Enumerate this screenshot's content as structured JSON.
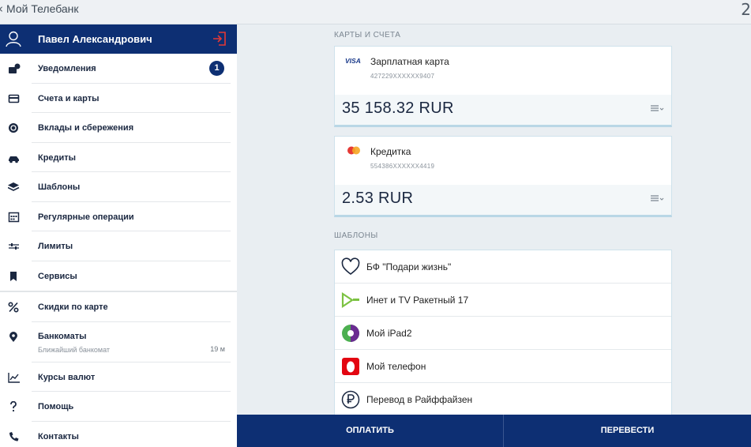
{
  "topbar": {
    "back_glyph": "‹",
    "title": "Мой Телебанк",
    "right_glyph": "2"
  },
  "profile": {
    "name": "Павел Александрович",
    "avatar_icon": "user-icon",
    "logout_icon": "logout-icon"
  },
  "menu": [
    {
      "label": "Уведомления",
      "icon": "notifications-icon",
      "badge": "1"
    },
    {
      "label": "Счета и карты",
      "icon": "card-icon"
    },
    {
      "label": "Вклады и сбережения",
      "icon": "savings-icon"
    },
    {
      "label": "Кредиты",
      "icon": "credit-icon"
    },
    {
      "label": "Шаблоны",
      "icon": "templates-icon"
    },
    {
      "label": "Регулярные операции",
      "icon": "calendar-icon"
    },
    {
      "label": "Лимиты",
      "icon": "limits-icon"
    },
    {
      "label": "Сервисы",
      "icon": "bookmark-icon"
    },
    {
      "label": "Скидки по карте",
      "icon": "percent-icon"
    },
    {
      "label": "Банкоматы",
      "icon": "location-icon",
      "sub": "Ближайший банкомат",
      "dist": "19 м"
    },
    {
      "label": "Курсы валют",
      "icon": "chart-icon"
    },
    {
      "label": "Помощь",
      "icon": "help-icon"
    },
    {
      "label": "Контакты",
      "icon": "phone-icon"
    }
  ],
  "accounts": {
    "title": "КАРТЫ И СЧЕТА",
    "cards": [
      {
        "name": "Зарплатная карта",
        "number": "427229XXXXXX9407",
        "amount": "35 158.32 RUR",
        "brand": "VISA"
      },
      {
        "name": "Кредитка",
        "number": "554386XXXXXX4419",
        "amount": "2.53 RUR",
        "brand": "MasterCard"
      }
    ]
  },
  "templates": {
    "title": "ШАБЛОНЫ",
    "items": [
      {
        "label": "БФ \"Подари жизнь\"",
        "icon": "heart-icon"
      },
      {
        "label": "Инет и  TV Ракетный 17",
        "icon": "provider-icon"
      },
      {
        "label": "Мой iPad2",
        "icon": "megafon-icon"
      },
      {
        "label": "Мой телефон",
        "icon": "mts-icon"
      },
      {
        "label": "Перевод в Райффайзен",
        "icon": "ruble-transfer-icon"
      }
    ]
  },
  "actions": {
    "pay": "ОПЛАТИТЬ",
    "transfer": "ПЕРЕВЕСТИ"
  },
  "colors": {
    "primary": "#0d2f73",
    "background": "#e9eef2"
  }
}
